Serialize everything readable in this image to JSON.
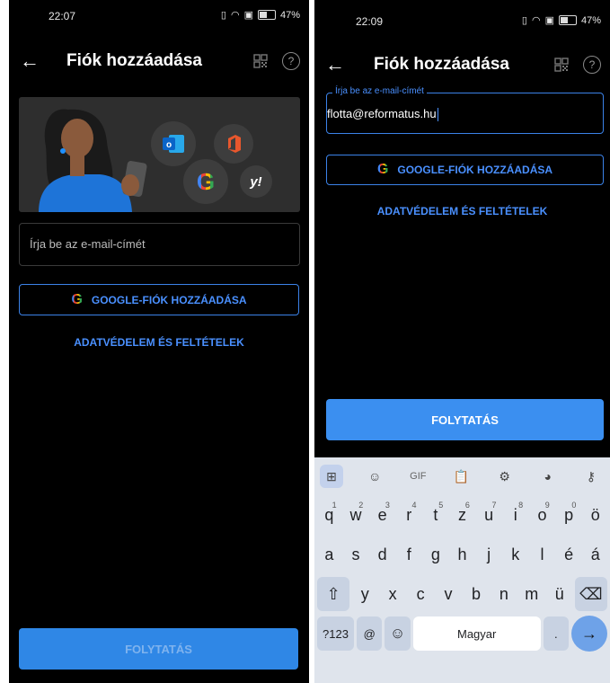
{
  "left": {
    "status": {
      "time": "22:07",
      "battery": "47%"
    },
    "appbar": {
      "title": "Fiók hozzáadása"
    },
    "email": {
      "placeholder": "Írja be az e-mail-címét"
    },
    "google_button": "GOOGLE-FIÓK HOZZÁADÁSA",
    "privacy_link": "ADATVÉDELEM ÉS FELTÉTELEK",
    "continue_button": "FOLYTATÁS"
  },
  "right": {
    "status": {
      "time": "22:09",
      "battery": "47%"
    },
    "appbar": {
      "title": "Fiók hozzáadása"
    },
    "email": {
      "label": "Írja be az e-mail-címét",
      "value": "flotta@reformatus.hu"
    },
    "google_button": "GOOGLE-FIÓK HOZZÁADÁSA",
    "privacy_link": "ADATVÉDELEM ÉS FELTÉTELEK",
    "continue_button": "FOLYTATÁS",
    "keyboard": {
      "gif_label": "GIF",
      "row1": [
        {
          "k": "q",
          "s": "1"
        },
        {
          "k": "w",
          "s": "2"
        },
        {
          "k": "e",
          "s": "3"
        },
        {
          "k": "r",
          "s": "4"
        },
        {
          "k": "t",
          "s": "5"
        },
        {
          "k": "z",
          "s": "6"
        },
        {
          "k": "u",
          "s": "7"
        },
        {
          "k": "i",
          "s": "8"
        },
        {
          "k": "o",
          "s": "9"
        },
        {
          "k": "p",
          "s": "0"
        },
        {
          "k": "ö",
          "s": ""
        }
      ],
      "row2": [
        "a",
        "s",
        "d",
        "f",
        "g",
        "h",
        "j",
        "k",
        "l",
        "é",
        "á"
      ],
      "row3": [
        "y",
        "x",
        "c",
        "v",
        "b",
        "n",
        "m",
        "ü"
      ],
      "numbers_key": "?123",
      "at_key": "@",
      "space_label": "Magyar",
      "period_key": "."
    }
  },
  "colors": {
    "accent": "#3b8ff0",
    "background": "#000000",
    "keyboard": "#dfe4ec"
  }
}
